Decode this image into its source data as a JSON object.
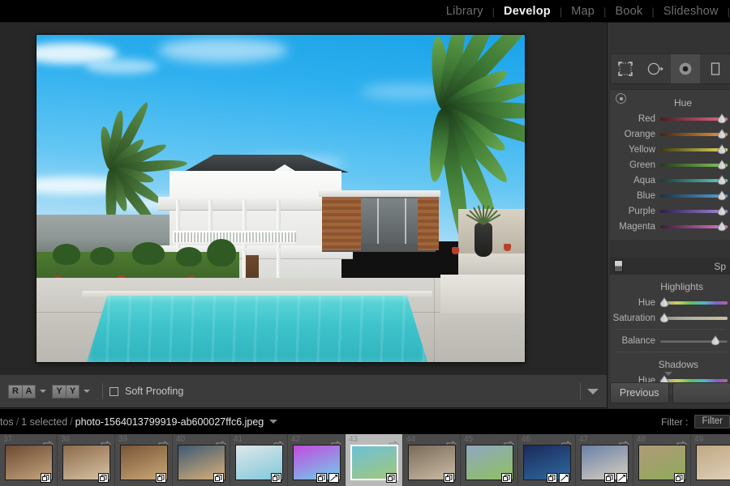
{
  "topbar": {
    "modules": [
      {
        "label": "Library",
        "active": false
      },
      {
        "label": "Develop",
        "active": true
      },
      {
        "label": "Map",
        "active": false
      },
      {
        "label": "Book",
        "active": false
      },
      {
        "label": "Slideshow",
        "active": false
      }
    ],
    "separator": "|"
  },
  "toolbar": {
    "before_after_left": "R",
    "before_after_right": "A",
    "compare_left": "Y",
    "compare_right": "Y",
    "soft_proofing_label": "Soft Proofing",
    "soft_proofing_checked": false,
    "caret_icon": "chevron-down-icon"
  },
  "right_panel": {
    "tools": [
      {
        "name": "crop-overlay-tool",
        "selected": false
      },
      {
        "name": "spot-removal-tool",
        "selected": false
      },
      {
        "name": "red-eye-tool",
        "selected": true
      },
      {
        "name": "graduated-filter-tool",
        "selected": false
      }
    ],
    "hsl_panel": {
      "title": "Hue",
      "target_adjust_icon": "target-adjust-icon",
      "sliders": [
        {
          "label": "Red",
          "value": 0,
          "from": "#4a1a22",
          "to": "#f06a8a"
        },
        {
          "label": "Orange",
          "value": 0,
          "from": "#432616",
          "to": "#f09a3a"
        },
        {
          "label": "Yellow",
          "value": 0,
          "from": "#3e3a14",
          "to": "#e8e05a"
        },
        {
          "label": "Green",
          "value": 0,
          "from": "#27381a",
          "to": "#86d060"
        },
        {
          "label": "Aqua",
          "value": 0,
          "from": "#1b3a38",
          "to": "#58d8c8"
        },
        {
          "label": "Blue",
          "value": 0,
          "from": "#1c2f46",
          "to": "#56a8e6"
        },
        {
          "label": "Purple",
          "value": 0,
          "from": "#2e1f42",
          "to": "#a88ae8"
        },
        {
          "label": "Magenta",
          "value": 0,
          "from": "#3e1a36",
          "to": "#e878d0"
        }
      ]
    },
    "split_toning_panel": {
      "title": "Sp",
      "panel_icon": "panel-switch-icon",
      "highlights_label": "Highlights",
      "highlights": [
        {
          "label": "Hue",
          "value": 0
        },
        {
          "label": "Saturation",
          "value": 0
        }
      ],
      "balance_label": "Balance",
      "balance_value": 0,
      "shadows_label": "Shadows",
      "shadows": [
        {
          "label": "Hue",
          "value": 0
        }
      ]
    },
    "buttons": {
      "previous": "Previous"
    },
    "collapse_caret": "chevron-down-icon"
  },
  "filmstrip": {
    "breadcrumb": {
      "source": "tos",
      "selected": "1 selected",
      "filename": "photo-1564013799919-ab600027ffc6.jpeg",
      "separator": "/",
      "caret_icon": "chevron-down-icon"
    },
    "filter": {
      "label": "Filter :",
      "value": "Filter"
    },
    "thumbnails": [
      {
        "number": "37",
        "selected": false,
        "badges": [
          "stack"
        ],
        "c1": "#6d4a33",
        "c2": "#c3a47e"
      },
      {
        "number": "38",
        "selected": false,
        "badges": [
          "stack"
        ],
        "c1": "#8c6a4a",
        "c2": "#d8c3a4"
      },
      {
        "number": "39",
        "selected": false,
        "badges": [
          "stack"
        ],
        "c1": "#7a5536",
        "c2": "#c9a878"
      },
      {
        "number": "40",
        "selected": false,
        "badges": [
          "stack"
        ],
        "c1": "#3f5a72",
        "c2": "#d8b07a"
      },
      {
        "number": "41",
        "selected": false,
        "badges": [
          "stack"
        ],
        "c1": "#dfe7ec",
        "c2": "#7fc8d8"
      },
      {
        "number": "42",
        "selected": false,
        "badges": [
          "stack",
          "crop"
        ],
        "c1": "#c34ae0",
        "c2": "#6fd0e8"
      },
      {
        "number": "43",
        "selected": true,
        "badges": [
          "stack"
        ],
        "c1": "#6ec0d8",
        "c2": "#9fc87a"
      },
      {
        "number": "44",
        "selected": false,
        "badges": [
          "stack"
        ],
        "c1": "#7a6a58",
        "c2": "#cbbda8"
      },
      {
        "number": "45",
        "selected": false,
        "badges": [
          "stack"
        ],
        "c1": "#8fa8c0",
        "c2": "#8fc060"
      },
      {
        "number": "46",
        "selected": false,
        "badges": [
          "stack",
          "crop"
        ],
        "c1": "#1b2a5a",
        "c2": "#2f6aa0"
      },
      {
        "number": "47",
        "selected": false,
        "badges": [
          "stack",
          "crop"
        ],
        "c1": "#6a7fa8",
        "c2": "#d8d0c0"
      },
      {
        "number": "48",
        "selected": false,
        "badges": [
          "stack"
        ],
        "c1": "#b09a7a",
        "c2": "#8faa5a"
      },
      {
        "number": "49",
        "selected": false,
        "badges": [
          "stack"
        ],
        "c1": "#c0a882",
        "c2": "#e0d2bc"
      }
    ]
  }
}
